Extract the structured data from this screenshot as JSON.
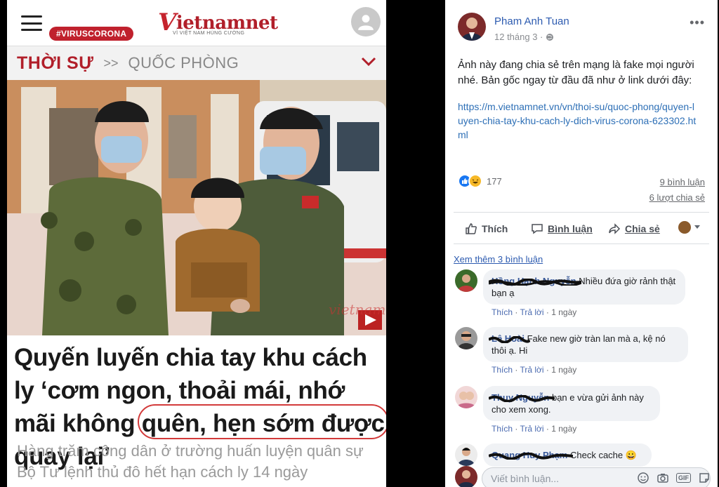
{
  "article": {
    "tag": "#VIRUSCORONA",
    "logo_main": "ietnamnet",
    "logo_v": "V",
    "logo_sub": "VÌ VIỆT NAM HÙNG CƯỜNG",
    "breadcrumb_main": "THỜI SỰ",
    "breadcrumb_sep": ">>",
    "breadcrumb_sub": "QUỐC PHÒNG",
    "photo_watermark": "vietnamnet",
    "headline": "Quyến luyến chia tay khu cách ly ‘cơm ngon, thoải mái, nhớ mãi không quên, hẹn sớm được quay lại’",
    "subtext": "Hàng trăm công dân ở trường huấn luyện quân sự Bộ Tư lệnh thủ đô hết hạn cách ly 14 ngày"
  },
  "post": {
    "author": "Pham Anh Tuan",
    "time": "12 tháng 3 ·",
    "more": "•••",
    "text": "Ảnh này đang chia sẻ trên mạng là fake mọi người nhé. Bản gốc ngay từ đầu đã như ở link dưới đây:",
    "link": "https://m.vietnamnet.vn/vn/thoi-su/quoc-phong/quyen-luyen-chia-tay-khu-cach-ly-dich-virus-corona-623302.html",
    "reaction_count": "177",
    "comment_count": "9 bình luận",
    "share_count": "6 lượt chia sẻ",
    "actions": {
      "like": "Thích",
      "comment": "Bình luận",
      "share": "Chia sẻ"
    },
    "see_more": "Xem thêm 3 bình luận",
    "comments": [
      {
        "author": "Hồng Hạnh Nguyễn",
        "text": "Nhiều đứa giờ rảnh thật bạn ạ",
        "like": "Thích",
        "reply": "Trả lời",
        "time": "1 ngày"
      },
      {
        "author": "Lê Hoài",
        "text": "Fake new giờ tràn lan mà a, kệ nó thôi ạ. Hi",
        "like": "Thích",
        "reply": "Trả lời",
        "time": "1 ngày"
      },
      {
        "author": "Thuy Nguyễn",
        "text": "bạn e vừa gửi ảnh này cho xem xong.",
        "like": "Thích",
        "reply": "Trả lời",
        "time": "1 ngày"
      },
      {
        "author": "Quang Huy Phạm",
        "text": "Check cache 😀"
      }
    ],
    "write_placeholder": "Viết bình luận...",
    "gif_label": "GIF"
  }
}
